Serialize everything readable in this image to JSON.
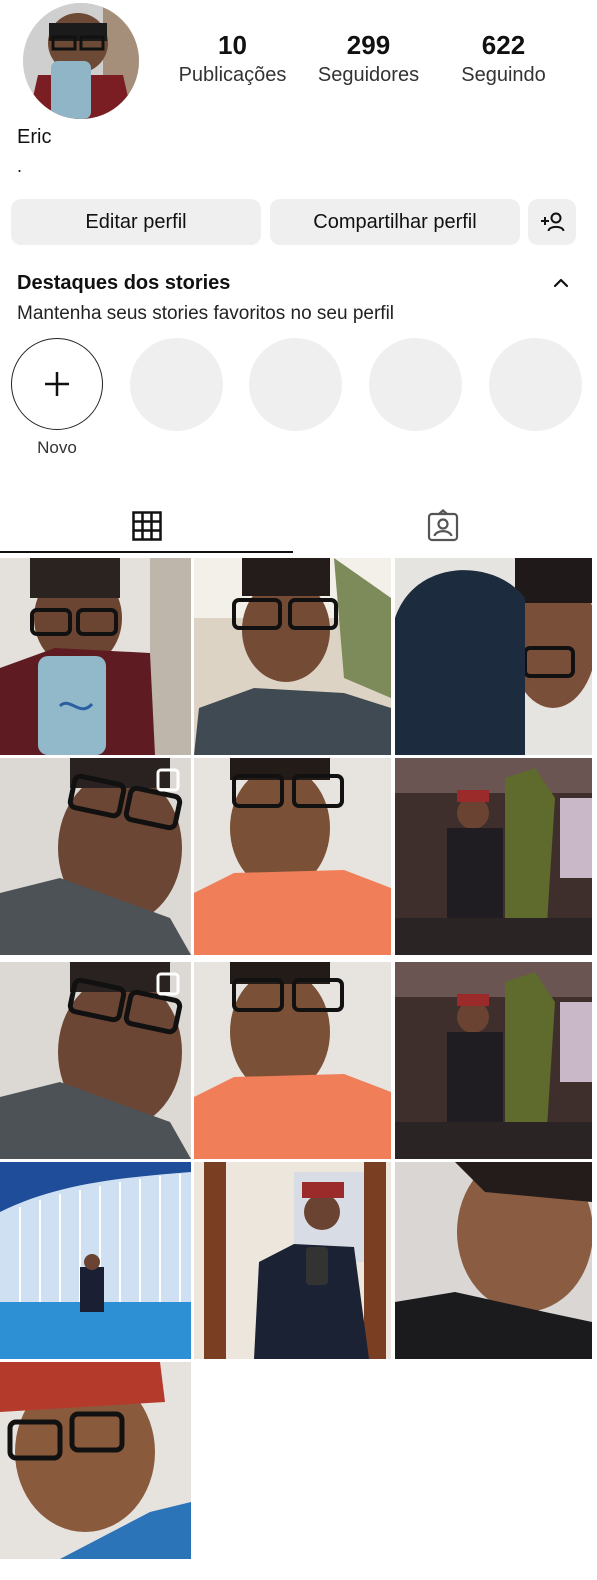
{
  "profile": {
    "name": "Eric",
    "bio": ".",
    "stats": [
      {
        "value": "10",
        "label": "Publicações"
      },
      {
        "value": "299",
        "label": "Seguidores"
      },
      {
        "value": "622",
        "label": "Seguindo"
      }
    ]
  },
  "buttons": {
    "edit": "Editar perfil",
    "share": "Compartilhar perfil",
    "add_icon": "add-person-icon"
  },
  "highlights": {
    "title": "Destaques dos stories",
    "subtitle": "Mantenha seus stories favoritos no seu perfil",
    "new_label": "Novo"
  },
  "tabs": [
    {
      "icon": "grid-icon",
      "active": true
    },
    {
      "icon": "tagged-icon",
      "active": false
    }
  ],
  "colors": {
    "button_bg": "#efefef",
    "text": "#111111",
    "placeholder": "#efefef"
  },
  "posts_count_visible": 13
}
